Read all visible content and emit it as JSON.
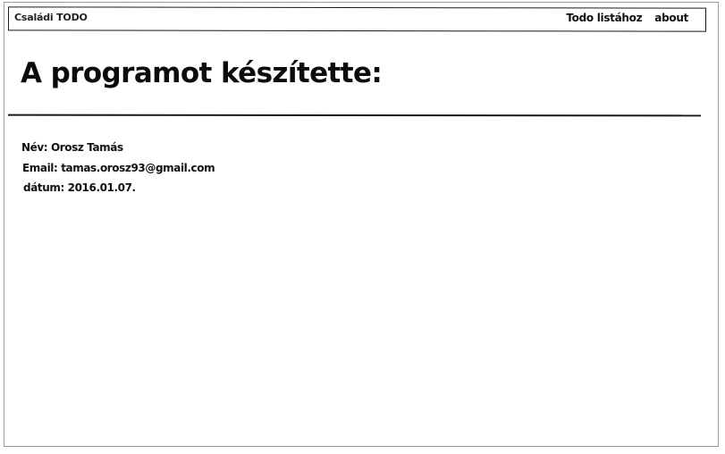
{
  "navbar": {
    "brand": "Családi TODO",
    "links": [
      "Todo listához",
      "about"
    ]
  },
  "main": {
    "title": "A programot készítette:",
    "info": {
      "name": "Név: Orosz Tamás",
      "email": "Email: tamas.orosz93@gmail.com",
      "date": "dátum: 2016.01.07."
    }
  },
  "colors": {
    "text": "#111111",
    "border": "#1a1a1a",
    "background": "#ffffff"
  }
}
